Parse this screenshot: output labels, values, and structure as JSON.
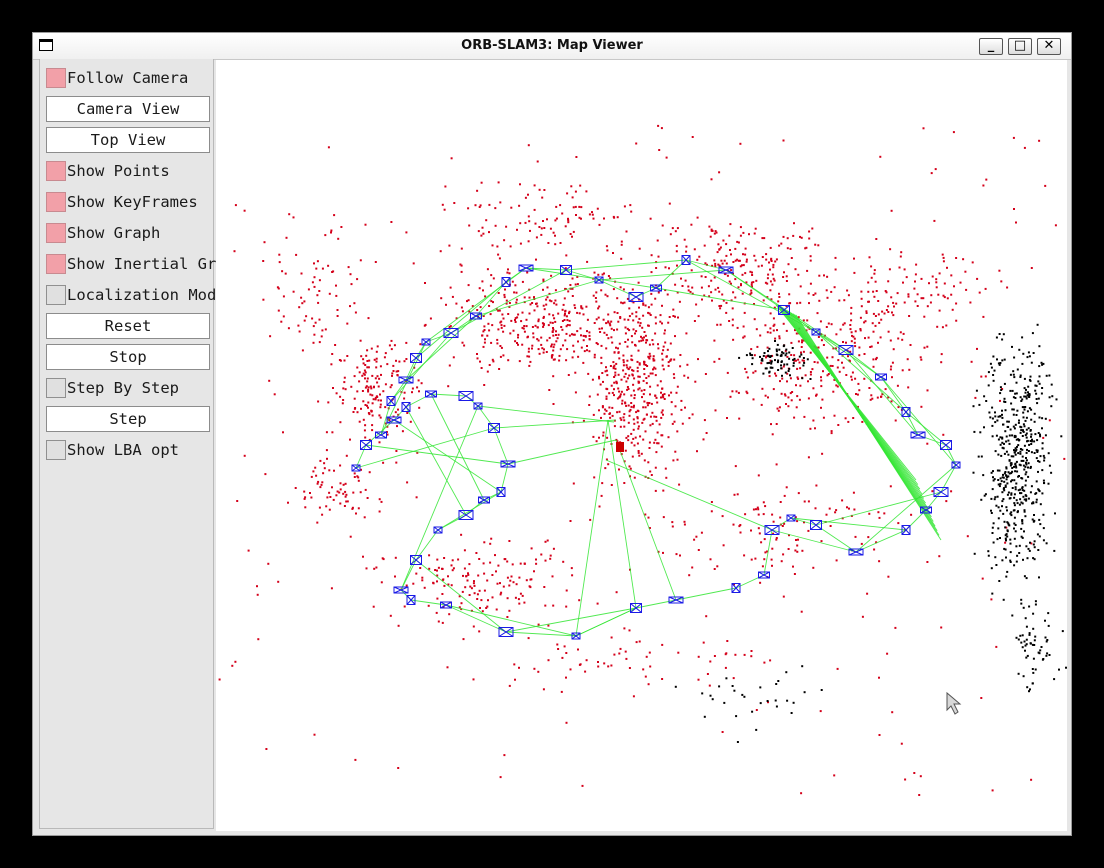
{
  "window": {
    "title": "ORB-SLAM3: Map Viewer"
  },
  "window_buttons": {
    "minimize": "_",
    "maximize": "□",
    "close": "✕"
  },
  "panel": {
    "follow_camera": {
      "label": "Follow Camera",
      "checked": true
    },
    "camera_view": "Camera View",
    "top_view": "Top View",
    "show_points": {
      "label": "Show Points",
      "checked": true
    },
    "show_keyframes": {
      "label": "Show KeyFrames",
      "checked": true
    },
    "show_graph": {
      "label": "Show Graph",
      "checked": true
    },
    "show_inertial_graph": {
      "label": "Show Inertial Graph",
      "checked": true
    },
    "localization_mode": {
      "label": "Localization Mode",
      "checked": false
    },
    "reset": "Reset",
    "stop": "Stop",
    "step_by_step": {
      "label": "Step By Step",
      "checked": false
    },
    "step": "Step",
    "show_lba_opt": {
      "label": "Show LBA opt",
      "checked": false
    }
  },
  "map": {
    "colors": {
      "local_map_points": "#d4001a",
      "reference_points": "#000000",
      "covisibility_graph": "#33e633",
      "keyframes": "#1a1ae6",
      "current_camera": "#cc0000"
    }
  }
}
